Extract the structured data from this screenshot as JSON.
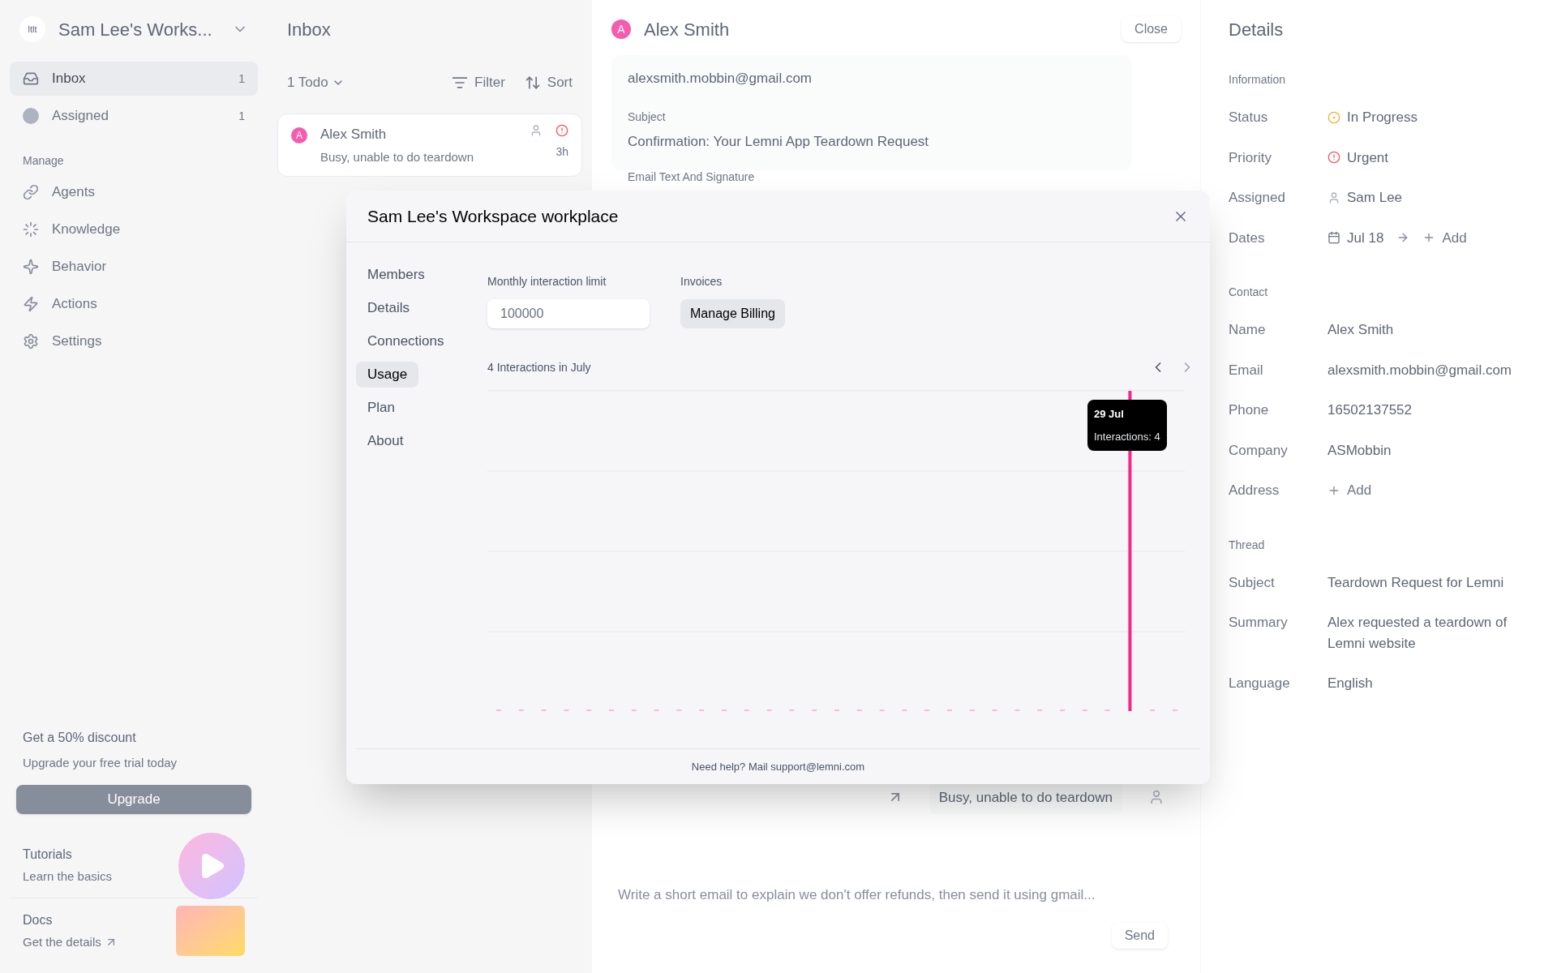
{
  "sidebar": {
    "workspace": "Sam Lee's Works...",
    "logo": "ltlt",
    "nav": [
      {
        "label": "Inbox",
        "count": "1",
        "selected": true,
        "kind": "inbox"
      },
      {
        "label": "Assigned",
        "count": "1",
        "selected": false,
        "kind": "assigned"
      }
    ],
    "manage_heading": "Manage",
    "manage": [
      {
        "label": "Agents",
        "kind": "link"
      },
      {
        "label": "Knowledge",
        "kind": "knowledge"
      },
      {
        "label": "Behavior",
        "kind": "sparkle"
      },
      {
        "label": "Actions",
        "kind": "bolt"
      },
      {
        "label": "Settings",
        "kind": "settings"
      }
    ],
    "promo": {
      "title": "Get a 50% discount",
      "subtitle": "Upgrade your free trial today",
      "button": "Upgrade"
    },
    "tutorials": {
      "title": "Tutorials",
      "subtitle": "Learn the basics"
    },
    "docs": {
      "title": "Docs",
      "link": "Get the details"
    }
  },
  "inbox": {
    "title": "Inbox",
    "status_filter": "1 Todo",
    "filter": "Filter",
    "sort": "Sort",
    "items": [
      {
        "avatar": "A",
        "name": "Alex Smith",
        "preview": "Busy, unable to do teardown",
        "time": "3h",
        "selected": true
      }
    ]
  },
  "conversation": {
    "avatar": "A",
    "name": "Alex Smith",
    "close": "Close",
    "to": "alexsmith.mobbin@gmail.com",
    "subject_label": "Subject",
    "subject": "Confirmation: Your Lemni App Teardown Request",
    "body_label": "Email Text And Signature",
    "message": "Busy, unable to do teardown",
    "composer_placeholder": "Write a short email to explain we don't offer refunds, then send it using gmail...",
    "send": "Send"
  },
  "details": {
    "title": "Details",
    "sections": [
      {
        "heading": "Information",
        "rows": [
          {
            "label": "Status",
            "kind": "status",
            "value": "In Progress"
          },
          {
            "label": "Priority",
            "kind": "priority",
            "value": "Urgent"
          },
          {
            "label": "Assigned",
            "kind": "person",
            "value": "Sam Lee"
          },
          {
            "label": "Dates",
            "kind": "dates",
            "value": "Jul 18",
            "add": "Add"
          }
        ]
      },
      {
        "heading": "Contact",
        "rows": [
          {
            "label": "Name",
            "kind": "text",
            "value": "Alex Smith"
          },
          {
            "label": "Email",
            "kind": "text",
            "value": "alexsmith.mobbin@gmail.com"
          },
          {
            "label": "Phone",
            "kind": "text",
            "value": "16502137552"
          },
          {
            "label": "Company",
            "kind": "text",
            "value": "ASMobbin"
          },
          {
            "label": "Address",
            "kind": "add",
            "value": "Add"
          }
        ]
      },
      {
        "heading": "Thread",
        "rows": [
          {
            "label": "Subject",
            "kind": "text",
            "value": "Teardown Request for Lemni"
          },
          {
            "label": "Summary",
            "kind": "text",
            "value": "Alex requested a teardown of Lemni website"
          },
          {
            "label": "Language",
            "kind": "text",
            "value": "English"
          }
        ]
      }
    ]
  },
  "modal": {
    "title": "Sam Lee's Workspace workplace",
    "nav": [
      {
        "label": "Members",
        "selected": false
      },
      {
        "label": "Details",
        "selected": false
      },
      {
        "label": "Connections",
        "selected": false
      },
      {
        "label": "Usage",
        "selected": true
      },
      {
        "label": "Plan",
        "selected": false
      },
      {
        "label": "About",
        "selected": false
      }
    ],
    "limit_label": "Monthly interaction limit",
    "limit_placeholder": "100000",
    "invoices_label": "Invoices",
    "billing_button": "Manage Billing",
    "chart_title": "4 Interactions in July",
    "tooltip_date": "29 Jul",
    "tooltip_text": "Interactions: 4",
    "footer": "Need help? Mail support@lemni.com"
  }
}
